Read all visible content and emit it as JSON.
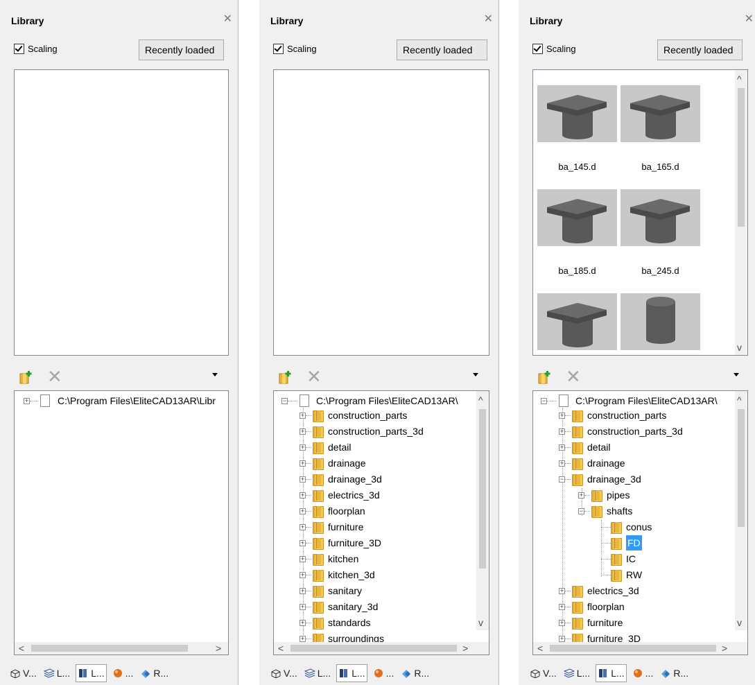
{
  "panels": [
    {
      "title": "Library",
      "close_glyph": "✕",
      "scaling_label": "Scaling",
      "recent_label": "Recently loaded",
      "tree_root": "C:\\Program Files\\EliteCAD13AR\\Libr",
      "tabs": [
        "V...",
        "L...",
        "L...",
        "...",
        "R..."
      ]
    },
    {
      "title": "Library",
      "close_glyph": "✕",
      "scaling_label": "Scaling",
      "recent_label": "Recently loaded",
      "tree_root": "C:\\Program Files\\EliteCAD13AR\\",
      "tree_items": [
        "construction_parts",
        "construction_parts_3d",
        "detail",
        "drainage",
        "drainage_3d",
        "electrics_3d",
        "floorplan",
        "furniture",
        "furniture_3D",
        "kitchen",
        "kitchen_3d",
        "sanitary",
        "sanitary_3d",
        "standards",
        "surroundings"
      ],
      "tabs": [
        "V...",
        "L...",
        "L...",
        "...",
        "R..."
      ]
    },
    {
      "title": "Library",
      "close_glyph": "✕",
      "scaling_label": "Scaling",
      "recent_label": "Recently loaded",
      "tree_root": "C:\\Program Files\\EliteCAD13AR\\",
      "thumbnails": [
        "ba_145.d",
        "ba_165.d",
        "ba_185.d",
        "ba_245.d"
      ],
      "tree_items": [
        "construction_parts",
        "construction_parts_3d",
        "detail",
        "drainage",
        "drainage_3d",
        "pipes",
        "shafts",
        "conus",
        "FD",
        "IC",
        "RW",
        "electrics_3d",
        "floorplan",
        "furniture",
        "furniture_3D"
      ],
      "selected_item": "FD",
      "tabs": [
        "V...",
        "L...",
        "L...",
        "...",
        "R..."
      ]
    }
  ],
  "icons": {
    "add_folder": "add-folder-icon",
    "delete": "delete-icon",
    "dropdown": "dropdown-icon",
    "tab_icons": [
      "view-icon",
      "layers-icon",
      "library-icon",
      "render-icon",
      "properties-icon"
    ]
  },
  "colors": {
    "panel_bg": "#f0f0f0",
    "selection": "#3399ff",
    "folder": "#f0c84c"
  }
}
